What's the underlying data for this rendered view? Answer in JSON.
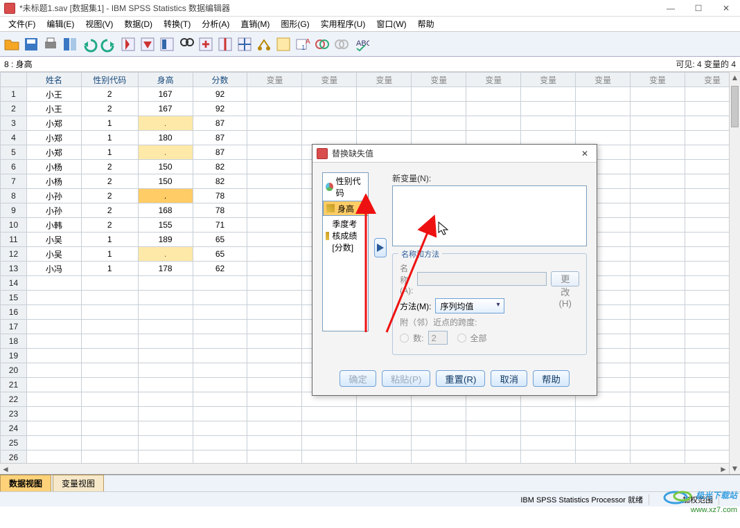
{
  "window": {
    "title": "*未标题1.sav [数据集1] - IBM SPSS Statistics 数据编辑器",
    "min": "—",
    "max": "☐",
    "close": "✕"
  },
  "menu": [
    "文件(F)",
    "编辑(E)",
    "视图(V)",
    "数据(D)",
    "转换(T)",
    "分析(A)",
    "直销(M)",
    "图形(G)",
    "实用程序(U)",
    "窗口(W)",
    "帮助"
  ],
  "refbar": {
    "cell": "8 : 身高",
    "visible": "可见: 4 变量的 4"
  },
  "columns": {
    "named": [
      "姓名",
      "性别代码",
      "身高",
      "分数"
    ],
    "blank_label": "变量",
    "blank_count": 9
  },
  "rows": [
    {
      "n": "1",
      "name": "小王",
      "sex": "2",
      "h": "167",
      "score": "92"
    },
    {
      "n": "2",
      "name": "小王",
      "sex": "2",
      "h": "167",
      "score": "92"
    },
    {
      "n": "3",
      "name": "小郑",
      "sex": "1",
      "h": ".",
      "score": "87"
    },
    {
      "n": "4",
      "name": "小郑",
      "sex": "1",
      "h": "180",
      "score": "87"
    },
    {
      "n": "5",
      "name": "小郑",
      "sex": "1",
      "h": ".",
      "score": "87"
    },
    {
      "n": "6",
      "name": "小杨",
      "sex": "2",
      "h": "150",
      "score": "82"
    },
    {
      "n": "7",
      "name": "小杨",
      "sex": "2",
      "h": "150",
      "score": "82"
    },
    {
      "n": "8",
      "name": "小孙",
      "sex": "2",
      "h": ".",
      "score": "78",
      "active": true
    },
    {
      "n": "9",
      "name": "小孙",
      "sex": "2",
      "h": "168",
      "score": "78"
    },
    {
      "n": "10",
      "name": "小韩",
      "sex": "2",
      "h": "155",
      "score": "71"
    },
    {
      "n": "11",
      "name": "小吴",
      "sex": "1",
      "h": "189",
      "score": "65"
    },
    {
      "n": "12",
      "name": "小吴",
      "sex": "1",
      "h": ".",
      "score": "65"
    },
    {
      "n": "13",
      "name": "小冯",
      "sex": "1",
      "h": "178",
      "score": "62"
    }
  ],
  "empty_rows": 13,
  "tabs": {
    "data": "数据视图",
    "var": "变量视图"
  },
  "dialog": {
    "title": "替换缺失值",
    "vars": [
      {
        "label": "性别代码",
        "icon": "nom"
      },
      {
        "label": "身高",
        "icon": "scale",
        "selected": true
      },
      {
        "label": "季度考核成绩 [分数]",
        "icon": "scale"
      }
    ],
    "new_var_label": "新变量(N):",
    "group_legend": "名称和方法",
    "name_label": "名称(A):",
    "change_btn": "更改(H)",
    "method_label": "方法(M):",
    "method_value": "序列均值",
    "span_label": "附（邻）近点的跨度:",
    "span_num": "数:",
    "span_num_val": "2",
    "span_all": "全部",
    "buttons": {
      "ok": "确定",
      "paste": "粘贴(P)",
      "reset": "重置(R)",
      "cancel": "取消",
      "help": "帮助"
    }
  },
  "status": {
    "processor": "IBM SPSS Statistics Processor 就绪",
    "weight": "加权范围"
  },
  "watermark": {
    "line1": "极光下载站",
    "line2": "www.xz7.com"
  }
}
